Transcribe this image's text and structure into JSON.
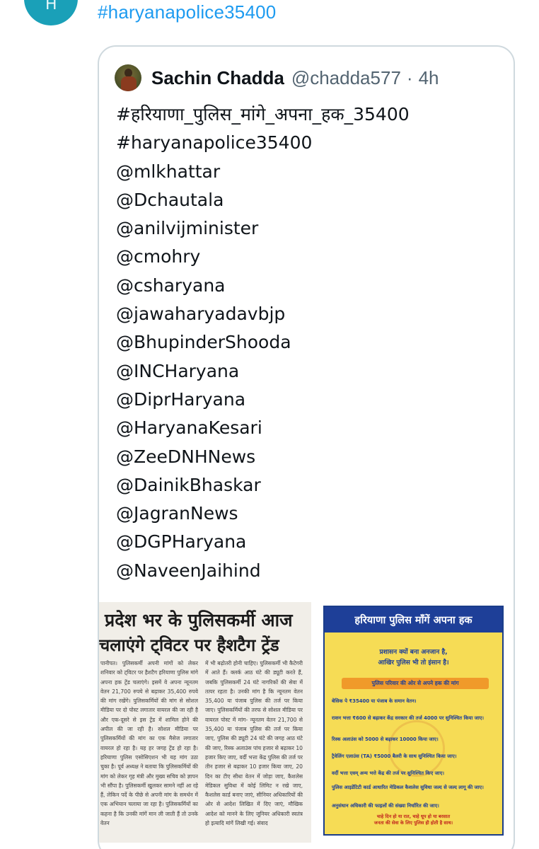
{
  "top_tweet": {
    "avatar_letter": "H",
    "hashtag": "#haryanapolice35400"
  },
  "quoted_tweet": {
    "author_name": "Sachin Chadda",
    "handle": "@chadda577",
    "separator": "·",
    "time": "4h",
    "lines": [
      "#हरियाणा_पुलिस_मांगे_अपना_हक_35400",
      "#haryanapolice35400",
      "@mlkhattar",
      "@Dchautala",
      "@anilvijminister",
      "@cmohry",
      "@csharyana",
      "@jawaharyadavbjp",
      "@BhupinderShooda",
      "@INCHaryana",
      "@DiprHaryana",
      "@HaryanaKesari",
      "@ZeeDNHNews",
      "@DainikBhaskar",
      "@JagranNews",
      "@DGPHaryana",
      "@NaveenJaihind"
    ]
  },
  "newspaper": {
    "headline_1": "प्रदेश भर के पुलिसकर्मी आज",
    "headline_2": "चलाएंगे ट्विटर पर हैशटैग ट्रेंड",
    "column_1": "पानीपत। पुलिसकर्मी अपनी मांगों को लेकर शनिवार को ट्विटर पर हैशटैग हरियाणा पुलिस मांगे अपना हक ट्रेंड चलाएंगे। इसमें वे अपना न्यूनतम वेतन 21,700 रुपये से बढ़ाकर 35,400 रुपये की मांग रखेंगे। पुलिसकर्मियों की मांग से सोशल मीडिया पर दो पोस्ट लगातार वायरल की जा रही है और एक-दूसरे से इस ट्रेंड में शामिल होने की अपील की जा रही है। सोशल मीडिया पर पुलिसकर्मियों की मांग का एक मैसेज लगातार वायरल हो रहा है। यह हर जगह ट्रेंड हो रहा है। हरियाणा पुलिस एसोसिएशन भी यह मांग उठा चुका है। पूर्व अध्यक्ष ने बताया कि पुलिसकर्मियों की मांग को लेकर गृह मंत्री और मुख्य सचिव को ज्ञापन भी सौंपा है। पुलिसकर्मी खुलकर सामने नहीं आ रहे हैं, लेकिन पर्दे के पीछे से अपनी मांग के समर्थन में एक अभियान चलाया जा रहा है। पुलिसकर्मियों का कहना है कि उनकी मांगें मान ली जाती हैं तो उनके वेतन",
    "column_2": "में भी बढ़ोतरी होनी चाहिए। पुलिसकर्मी भी कैटेगरी में आते हैं। क्लर्क आठ घंटे की ड्यूटी करते हैं, जबकि पुलिसकर्मी 24 घंटे नागरिकों की सेवा में तत्पर रहता है। उनकी मांग है कि न्यूनतम वेतन 35,400 या पंजाब पुलिस की तर्ज पर किया जाए। पुलिसकर्मियों की तरफ से सोशल मीडिया पर वायरल पोस्ट में मांग- न्यूनतम वेतन 21,700 से 35,400 या पंजाब पुलिस की तर्ज पर किया जाए, पुलिस की ड्यूटी 24 घंटे की जगह आठ घंटे की जाए, रिस्क अलाउंस पांच हजार से बढ़ाकर 10 हजार किए जाए, वर्दी भत्ता केंद्र पुलिस की तर्ज पर तीन हजार से बढ़ाकर 10 हजार किया जाए, 20 दिन का टीए सीधा वेतन में जोड़ा जाए, कैशलेस मेडिकल सुविधा में कोई लिमिट न रखे जाए, कैशलेस कार्ड बनाए जाएं, सीनियर अधिकारियों की ओर से आदेश लिखित में दिए जाएं, मौखिक आदेश को मानने के लिए जूनियर अधिकारी स्वतंत्र हो इत्यादि मांगें लिखी गई। संवाद"
  },
  "poster": {
    "title": "हरियाणा पुलिस माँगें अपना हक",
    "subtitle_1": "प्रशासन क्यों बना अनजान है,",
    "subtitle_2": "आखिर पुलिस भी तो इंसान है।",
    "band": "पुलिस परिवार की ओर से अपने हक की मांग",
    "items": [
      "बेसिक पे ₹35400 या पंजाब के समान वेतन।",
      "राशन भत्ता ₹600 से बढ़ाकर केंद्र सरकार की तर्ज 4000 पर सुनिश्चित किया जाए।",
      "रिस्क अलाउंस को 5000 से बढ़ाकर 10000 किया जाए।",
      "ट्रैवेलिंग एलाउंस (TA) ₹5000 बैलरी के साथ सुनिश्चित किया जाए।",
      "वर्दी भत्ता एवम् अन्य भत्ते केंद्र की तर्ज पर सुनिश्चित किए जाए।",
      "पुलिस आइडेंटिटी कार्ड आधारित मेडिकल कैशलेस सुविधा जल्द से जल्द लागू की जाए।",
      "अनुसंधान अधिकारी की फाइलों की संख्या निर्धारित की जाए।"
    ],
    "footer_1": "चाहे दिन हो या रात, चाहे धूप हो या बरसात",
    "footer_2": "जनता की सेवा के लिए पुलिस ही होती है साथ।"
  },
  "colors": {
    "link": "#1d9bf0",
    "muted": "#536471",
    "border": "#cfd9de",
    "poster_blue": "#1e3f98",
    "poster_yellow": "#f6dc55"
  }
}
